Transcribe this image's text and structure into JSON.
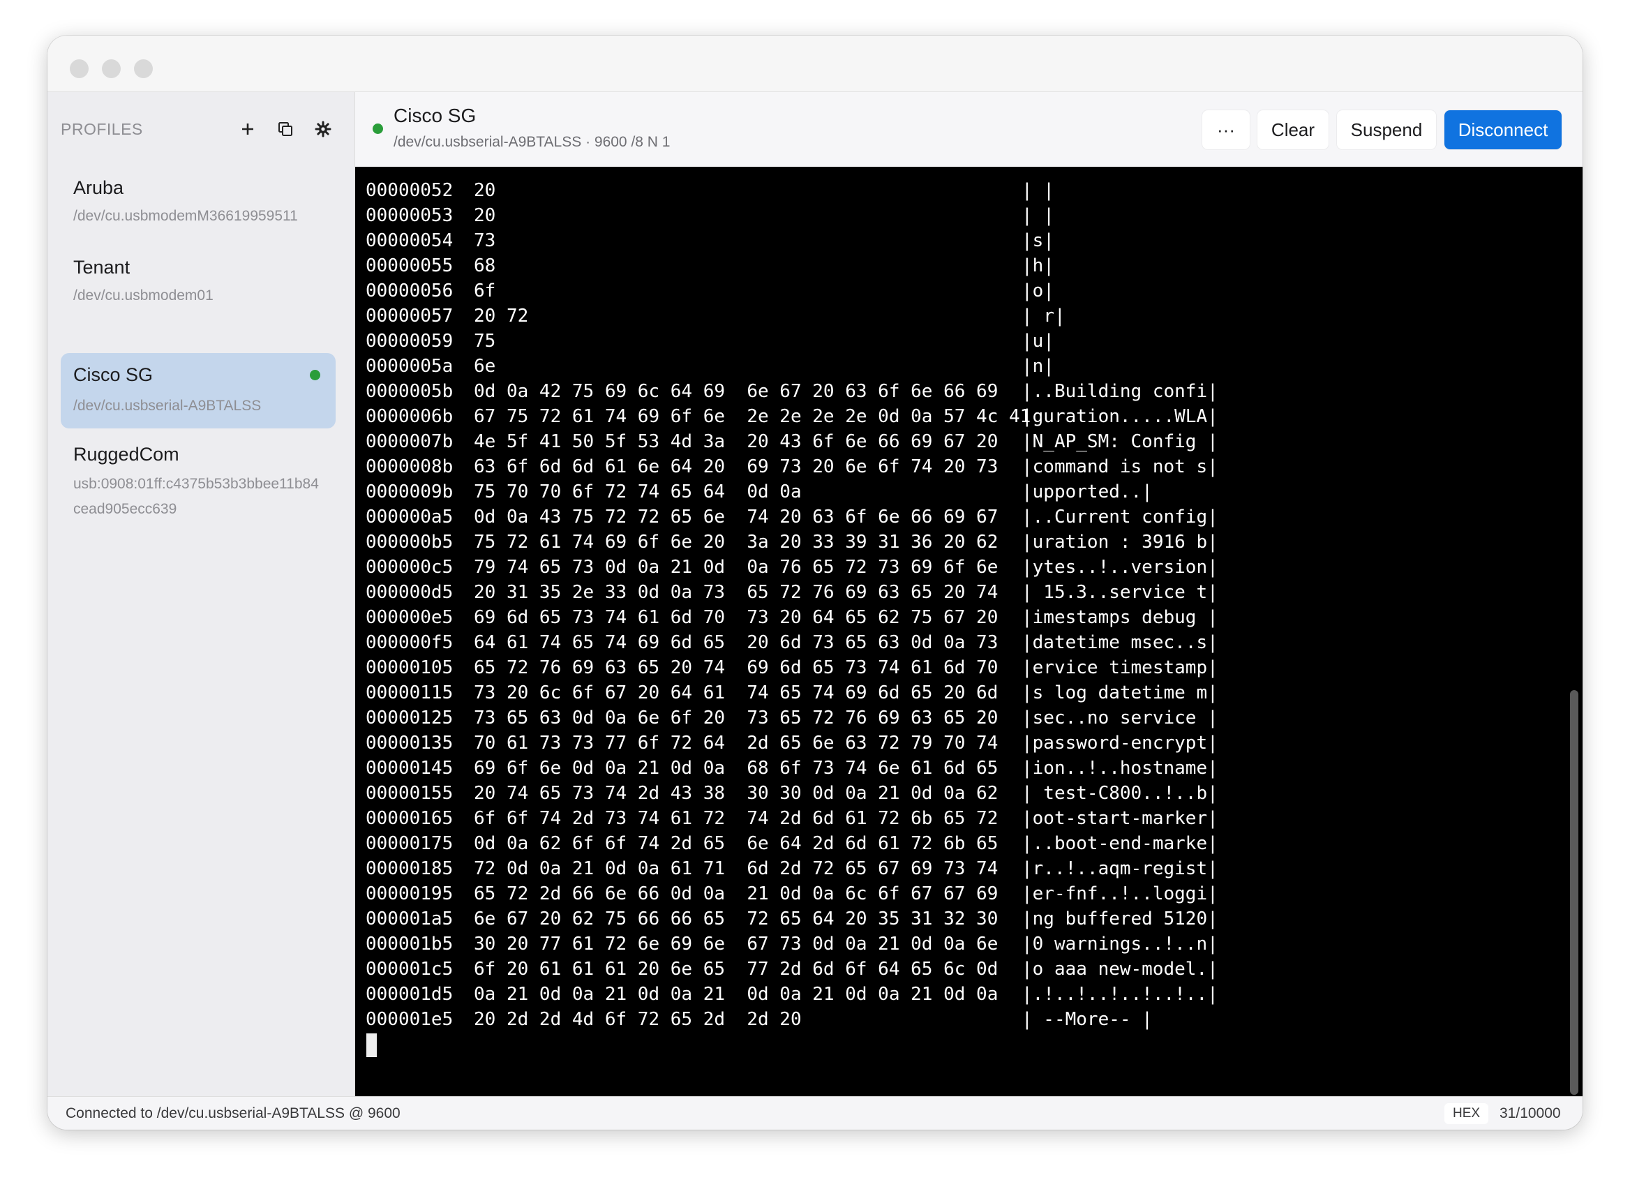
{
  "sidebar": {
    "heading": "PROFILES",
    "profiles": [
      {
        "name": "Aruba",
        "path": "/dev/cu.usbmodemM36619959511"
      },
      {
        "name": "Tenant",
        "path": "/dev/cu.usbmodem01"
      },
      {
        "name": "Cisco SG",
        "path": "/dev/cu.usbserial-A9BTALSS",
        "connected": true
      },
      {
        "name": "RuggedCom",
        "path": "usb:0908:01ff:c4375b53b3bbee11b84cead905ecc639"
      }
    ]
  },
  "header": {
    "title": "Cisco SG",
    "subtitle": "/dev/cu.usbserial-A9BTALSS · 9600 /8 N 1",
    "more_label": "···",
    "clear_label": "Clear",
    "suspend_label": "Suspend",
    "disconnect_label": "Disconnect"
  },
  "terminal": {
    "lines": [
      {
        "addr": "00000052",
        "hex": "20",
        "ascii": "| |"
      },
      {
        "addr": "00000053",
        "hex": "20",
        "ascii": "| |"
      },
      {
        "addr": "00000054",
        "hex": "73",
        "ascii": "|s|"
      },
      {
        "addr": "00000055",
        "hex": "68",
        "ascii": "|h|"
      },
      {
        "addr": "00000056",
        "hex": "6f",
        "ascii": "|o|"
      },
      {
        "addr": "00000057",
        "hex": "20 72",
        "ascii": "| r|"
      },
      {
        "addr": "00000059",
        "hex": "75",
        "ascii": "|u|"
      },
      {
        "addr": "0000005a",
        "hex": "6e",
        "ascii": "|n|"
      },
      {
        "addr": "0000005b",
        "hex": "0d 0a 42 75 69 6c 64 69  6e 67 20 63 6f 6e 66 69",
        "ascii": "|..Building confi|"
      },
      {
        "addr": "0000006b",
        "hex": "67 75 72 61 74 69 6f 6e  2e 2e 2e 2e 0d 0a 57 4c 41",
        "ascii": "|guration.....WLA|"
      },
      {
        "addr": "0000007b",
        "hex": "4e 5f 41 50 5f 53 4d 3a  20 43 6f 6e 66 69 67 20",
        "ascii": "|N_AP_SM: Config |"
      },
      {
        "addr": "0000008b",
        "hex": "63 6f 6d 6d 61 6e 64 20  69 73 20 6e 6f 74 20 73",
        "ascii": "|command is not s|"
      },
      {
        "addr": "0000009b",
        "hex": "75 70 70 6f 72 74 65 64  0d 0a",
        "ascii": "|upported..|"
      },
      {
        "addr": "000000a5",
        "hex": "0d 0a 43 75 72 72 65 6e  74 20 63 6f 6e 66 69 67",
        "ascii": "|..Current config|"
      },
      {
        "addr": "000000b5",
        "hex": "75 72 61 74 69 6f 6e 20  3a 20 33 39 31 36 20 62",
        "ascii": "|uration : 3916 b|"
      },
      {
        "addr": "000000c5",
        "hex": "79 74 65 73 0d 0a 21 0d  0a 76 65 72 73 69 6f 6e",
        "ascii": "|ytes..!..version|"
      },
      {
        "addr": "000000d5",
        "hex": "20 31 35 2e 33 0d 0a 73  65 72 76 69 63 65 20 74",
        "ascii": "| 15.3..service t|"
      },
      {
        "addr": "000000e5",
        "hex": "69 6d 65 73 74 61 6d 70  73 20 64 65 62 75 67 20",
        "ascii": "|imestamps debug |"
      },
      {
        "addr": "000000f5",
        "hex": "64 61 74 65 74 69 6d 65  20 6d 73 65 63 0d 0a 73",
        "ascii": "|datetime msec..s|"
      },
      {
        "addr": "00000105",
        "hex": "65 72 76 69 63 65 20 74  69 6d 65 73 74 61 6d 70",
        "ascii": "|ervice timestamp|"
      },
      {
        "addr": "00000115",
        "hex": "73 20 6c 6f 67 20 64 61  74 65 74 69 6d 65 20 6d",
        "ascii": "|s log datetime m|"
      },
      {
        "addr": "00000125",
        "hex": "73 65 63 0d 0a 6e 6f 20  73 65 72 76 69 63 65 20",
        "ascii": "|sec..no service |"
      },
      {
        "addr": "00000135",
        "hex": "70 61 73 73 77 6f 72 64  2d 65 6e 63 72 79 70 74",
        "ascii": "|password-encrypt|"
      },
      {
        "addr": "00000145",
        "hex": "69 6f 6e 0d 0a 21 0d 0a  68 6f 73 74 6e 61 6d 65",
        "ascii": "|ion..!..hostname|"
      },
      {
        "addr": "00000155",
        "hex": "20 74 65 73 74 2d 43 38  30 30 0d 0a 21 0d 0a 62",
        "ascii": "| test-C800..!..b|"
      },
      {
        "addr": "00000165",
        "hex": "6f 6f 74 2d 73 74 61 72  74 2d 6d 61 72 6b 65 72",
        "ascii": "|oot-start-marker|"
      },
      {
        "addr": "00000175",
        "hex": "0d 0a 62 6f 6f 74 2d 65  6e 64 2d 6d 61 72 6b 65",
        "ascii": "|..boot-end-marke|"
      },
      {
        "addr": "00000185",
        "hex": "72 0d 0a 21 0d 0a 61 71  6d 2d 72 65 67 69 73 74",
        "ascii": "|r..!..aqm-regist|"
      },
      {
        "addr": "00000195",
        "hex": "65 72 2d 66 6e 66 0d 0a  21 0d 0a 6c 6f 67 67 69",
        "ascii": "|er-fnf..!..loggi|"
      },
      {
        "addr": "000001a5",
        "hex": "6e 67 20 62 75 66 66 65  72 65 64 20 35 31 32 30",
        "ascii": "|ng buffered 5120|"
      },
      {
        "addr": "000001b5",
        "hex": "30 20 77 61 72 6e 69 6e  67 73 0d 0a 21 0d 0a 6e",
        "ascii": "|0 warnings..!..n|"
      },
      {
        "addr": "000001c5",
        "hex": "6f 20 61 61 61 20 6e 65  77 2d 6d 6f 64 65 6c 0d",
        "ascii": "|o aaa new-model.|"
      },
      {
        "addr": "000001d5",
        "hex": "0a 21 0d 0a 21 0d 0a 21  0d 0a 21 0d 0a 21 0d 0a",
        "ascii": "|.!..!..!..!..!..|"
      },
      {
        "addr": "000001e5",
        "hex": "20 2d 2d 4d 6f 72 65 2d  2d 20",
        "ascii": "| --More-- |"
      }
    ]
  },
  "status": {
    "text": "Connected to /dev/cu.usbserial-A9BTALSS @ 9600",
    "mode": "HEX",
    "count": "31/10000"
  },
  "colors": {
    "accent": "#1073e0",
    "connected": "#2a9d3a",
    "selected_profile": "#c4d6ec",
    "terminal_bg": "#000000"
  },
  "icons": {
    "add": "plus-icon",
    "duplicate": "duplicate-icon",
    "settings": "gear-icon"
  }
}
